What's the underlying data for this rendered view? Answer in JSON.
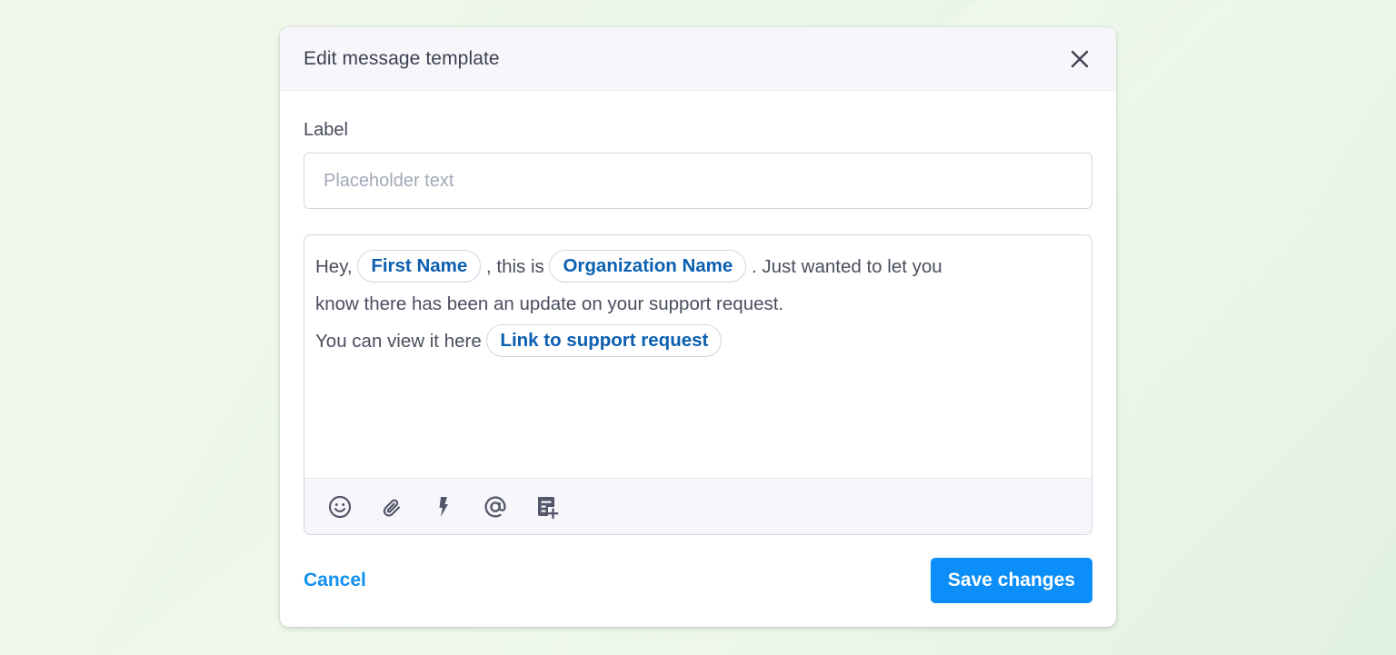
{
  "modal": {
    "title": "Edit message template"
  },
  "form": {
    "label": "Label",
    "input_placeholder": "Placeholder text",
    "input_value": ""
  },
  "editor": {
    "line1_text1": "Hey, ",
    "chip_first_name": "First Name",
    "line1_text2": " , this is ",
    "chip_org_name": "Organization Name",
    "line1_text3": "  . Just wanted to let you",
    "line2_text": "know there has been an update on your support request.",
    "line3_text1": "You can view it here ",
    "chip_link": "Link to support request",
    "toolbar_icons": [
      "emoji-icon",
      "attachment-icon",
      "bolt-icon",
      "mention-icon",
      "template-add-icon"
    ]
  },
  "footer": {
    "cancel_label": "Cancel",
    "save_label": "Save changes"
  },
  "colors": {
    "accent": "#0b8ef7",
    "link": "#1190ee",
    "chip_text": "#0b5fb0",
    "icon": "#545769"
  }
}
